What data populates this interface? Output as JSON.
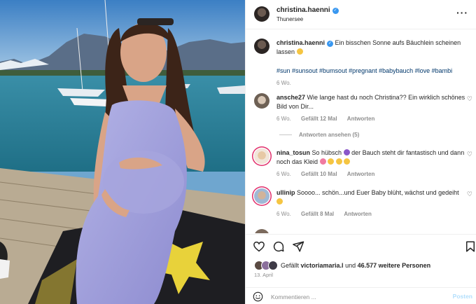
{
  "post": {
    "username": "christina.haenni",
    "location": "Thunersee",
    "caption": "Ein bisschen Sonne aufs Bäuchlein scheinen lassen",
    "hashtags": "#sun #sunsout #bumsout #pregnant #babybauch #love #bambi",
    "time": "6 Wo.",
    "more_icon": "more-horizontal-icon",
    "verified_icon": "verified-badge-icon"
  },
  "comments": [
    {
      "username": "ansche27",
      "text": "Wie lange hast du noch Christina?? Ein wirklich schönes Bild von Dir...",
      "time": "6 Wo.",
      "likes": "Gefällt 12 Mal",
      "reply": "Antworten",
      "view_replies": "Antworten ansehen (5)"
    },
    {
      "username": "nina_tosun",
      "text_a": "So hübsch",
      "text_b": "der Bauch steht dir fantastisch und dann noch das Kleid",
      "time": "6 Wo.",
      "likes": "Gefällt 10 Mal",
      "reply": "Antworten"
    },
    {
      "username": "ullinip",
      "text": "Soooo... schön...und Euer Baby blüht, wächst und gedeiht",
      "time": "6 Wo.",
      "likes": "Gefällt 8 Mal",
      "reply": "Antworten"
    }
  ],
  "actions": {
    "liked_by_prefix": "Gefällt",
    "liked_by_user": "victoriamaria.l",
    "liked_by_middle": "und",
    "liked_by_count": "46.577 weitere Personen",
    "date": "13. April",
    "comment_placeholder": "Kommentieren ...",
    "post_label": "Posten"
  },
  "colors": {
    "link": "#00376b",
    "meta": "#8e8e8e",
    "verified": "#3897f0",
    "post_disabled": "#b2dffc"
  }
}
